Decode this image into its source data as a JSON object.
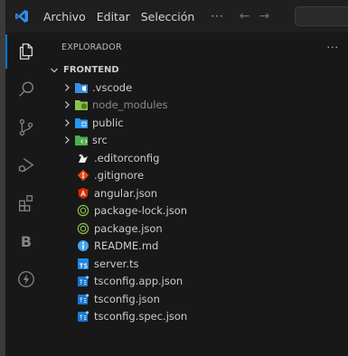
{
  "titlebar": {
    "menu": [
      "Archivo",
      "Editar",
      "Selección"
    ],
    "more": "···",
    "back": "←",
    "forward": "→"
  },
  "activitybar": {
    "letter_item": "B"
  },
  "explorer": {
    "title": "EXPLORADOR",
    "more": "···",
    "section": "FRONTEND",
    "folders": [
      {
        "label": ".vscode",
        "icon": "vscode-folder-icon",
        "color": "#3a8ee6",
        "dim": false
      },
      {
        "label": "node_modules",
        "icon": "node-folder-icon",
        "color": "#8bc34a",
        "dim": true
      },
      {
        "label": "public",
        "icon": "public-folder-icon",
        "color": "#2196f3",
        "dim": false
      },
      {
        "label": "src",
        "icon": "src-folder-icon",
        "color": "#4caf50",
        "dim": false
      }
    ],
    "files": [
      {
        "label": ".editorconfig",
        "icon": "editorconfig-icon"
      },
      {
        "label": ".gitignore",
        "icon": "git-icon"
      },
      {
        "label": "angular.json",
        "icon": "angular-icon"
      },
      {
        "label": "package-lock.json",
        "icon": "npm-icon"
      },
      {
        "label": "package.json",
        "icon": "npm-icon"
      },
      {
        "label": "README.md",
        "icon": "info-icon"
      },
      {
        "label": "server.ts",
        "icon": "typescript-icon"
      },
      {
        "label": "tsconfig.app.json",
        "icon": "tsconfig-icon"
      },
      {
        "label": "tsconfig.json",
        "icon": "tsconfig-icon"
      },
      {
        "label": "tsconfig.spec.json",
        "icon": "tsconfig-icon"
      }
    ]
  },
  "colors": {
    "accent": "#0078d4",
    "background": "#181818",
    "titlebar": "#1f1f1f"
  }
}
